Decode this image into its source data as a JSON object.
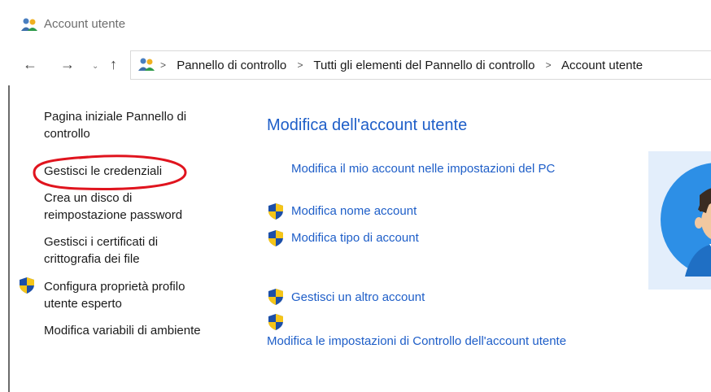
{
  "window": {
    "title": "Account utente"
  },
  "nav": {
    "back": "←",
    "forward": "→",
    "recent": "⌄",
    "up": "↑"
  },
  "breadcrumb": [
    "Pannello di controllo",
    "Tutti gli elementi del Pannello di controllo",
    "Account utente"
  ],
  "sidebar": {
    "items": [
      {
        "label": "Pagina iniziale Pannello di controllo"
      },
      {
        "label": "Gestisci le credenziali"
      },
      {
        "label": "Crea un disco di reimpostazione password"
      },
      {
        "label": "Gestisci i certificati di crittografia dei file"
      },
      {
        "label": "Configura proprietà profilo utente esperto"
      },
      {
        "label": "Modifica variabili di ambiente"
      }
    ]
  },
  "main": {
    "title": "Modifica dell'account utente",
    "links": [
      {
        "label": "Modifica il mio account nelle impostazioni del PC"
      },
      {
        "label": "Modifica nome account"
      },
      {
        "label": "Modifica tipo di account"
      },
      {
        "label": "Gestisci un altro account"
      },
      {
        "label": "Modifica le impostazioni di Controllo dell'account utente"
      }
    ]
  },
  "colors": {
    "link": "#1e5ec8",
    "annotation": "#e0141e",
    "avatar_bg": "#e3eefb"
  },
  "icons": [
    "users-icon",
    "shield-icon",
    "avatar-icon"
  ]
}
